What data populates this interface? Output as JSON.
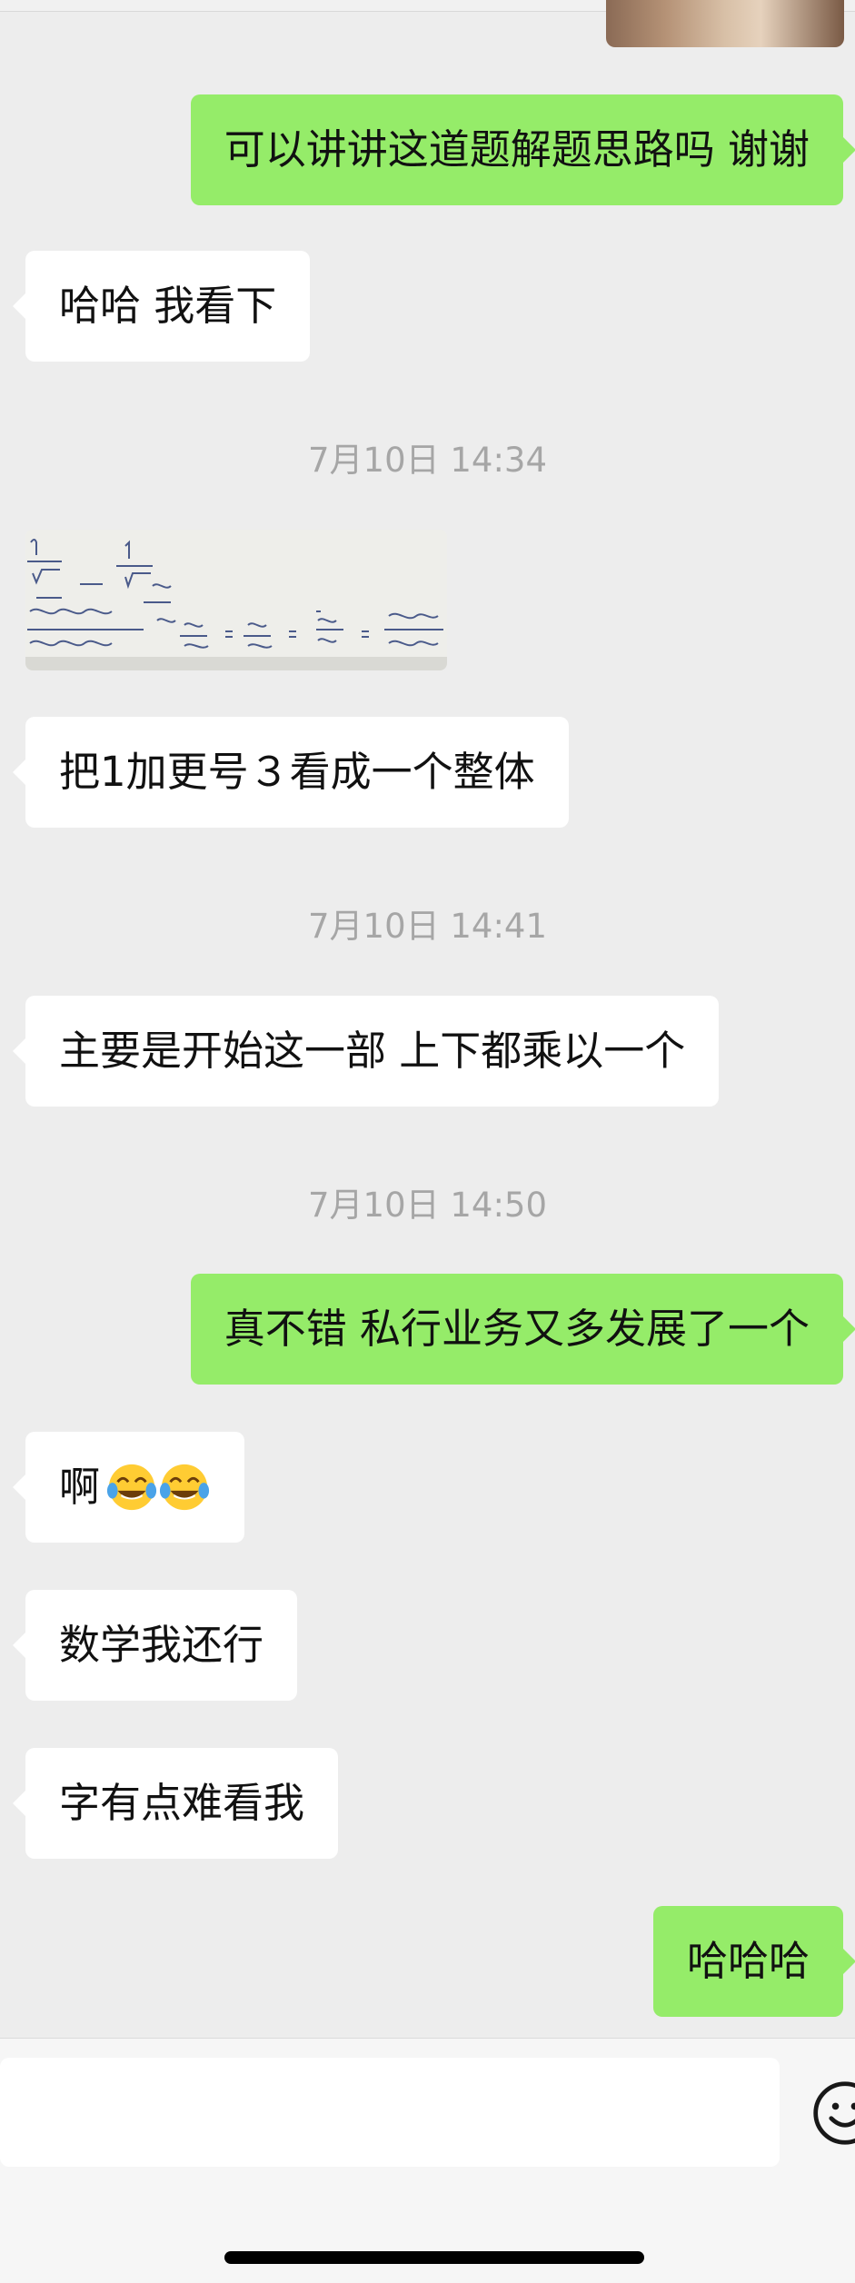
{
  "messages": [
    {
      "side": "right",
      "text": "可以讲讲这道题解题思路吗 谢谢"
    },
    {
      "side": "left",
      "text": "哈哈 我看下"
    },
    {
      "side": "left",
      "text": "把1加更号３看成一个整体"
    },
    {
      "side": "left",
      "text": "主要是开始这一部 上下都乘以一个"
    },
    {
      "side": "right",
      "text": "真不错 私行业务又多发展了一个"
    },
    {
      "side": "left",
      "text": "啊",
      "emoji": "tears-of-joy-emoji x2"
    },
    {
      "side": "left",
      "text": "数学我还行"
    },
    {
      "side": "left",
      "text": "字有点难看我"
    },
    {
      "side": "right",
      "text": "哈哈哈"
    }
  ],
  "timestamps": [
    "7月10日 14:34",
    "7月10日 14:41",
    "7月10日 14:50"
  ],
  "colors": {
    "background": "#ededed",
    "bubble_self": "#95ec69",
    "bubble_other": "#ffffff",
    "timestamp_text": "#a6a6a6"
  },
  "input": {
    "placeholder": ""
  }
}
